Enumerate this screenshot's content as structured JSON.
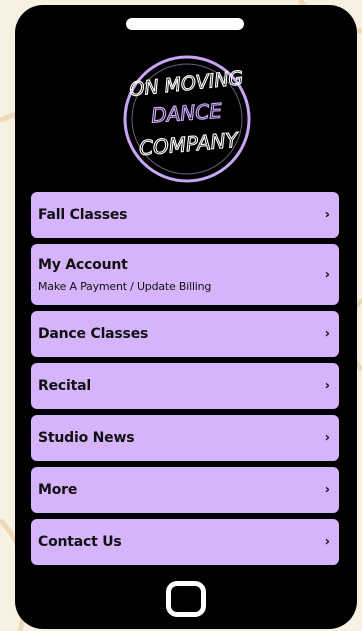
{
  "app": {
    "logo_lines": [
      "ON MOVING",
      "DANCE",
      "COMPANY"
    ]
  },
  "menu": {
    "items": [
      {
        "title": "Fall Classes",
        "subtitle": "",
        "chevron": "›"
      },
      {
        "title": "My Account",
        "subtitle": "Make A Payment / Update Billing",
        "chevron": "›"
      },
      {
        "title": "Dance Classes",
        "subtitle": "",
        "chevron": "›"
      },
      {
        "title": "Recital",
        "subtitle": "",
        "chevron": "›"
      },
      {
        "title": "Studio News",
        "subtitle": "",
        "chevron": "›"
      },
      {
        "title": "More",
        "subtitle": "",
        "chevron": "›"
      },
      {
        "title": "Contact Us",
        "subtitle": "",
        "chevron": "›"
      }
    ]
  },
  "colors": {
    "background": "#f7f1e1",
    "phone": "#000000",
    "menu_item": "#d6b4fb",
    "logo_accent": "#c9a6f5"
  },
  "icons": {
    "chevron": "chevron-right-icon",
    "home": "home-button-icon"
  }
}
